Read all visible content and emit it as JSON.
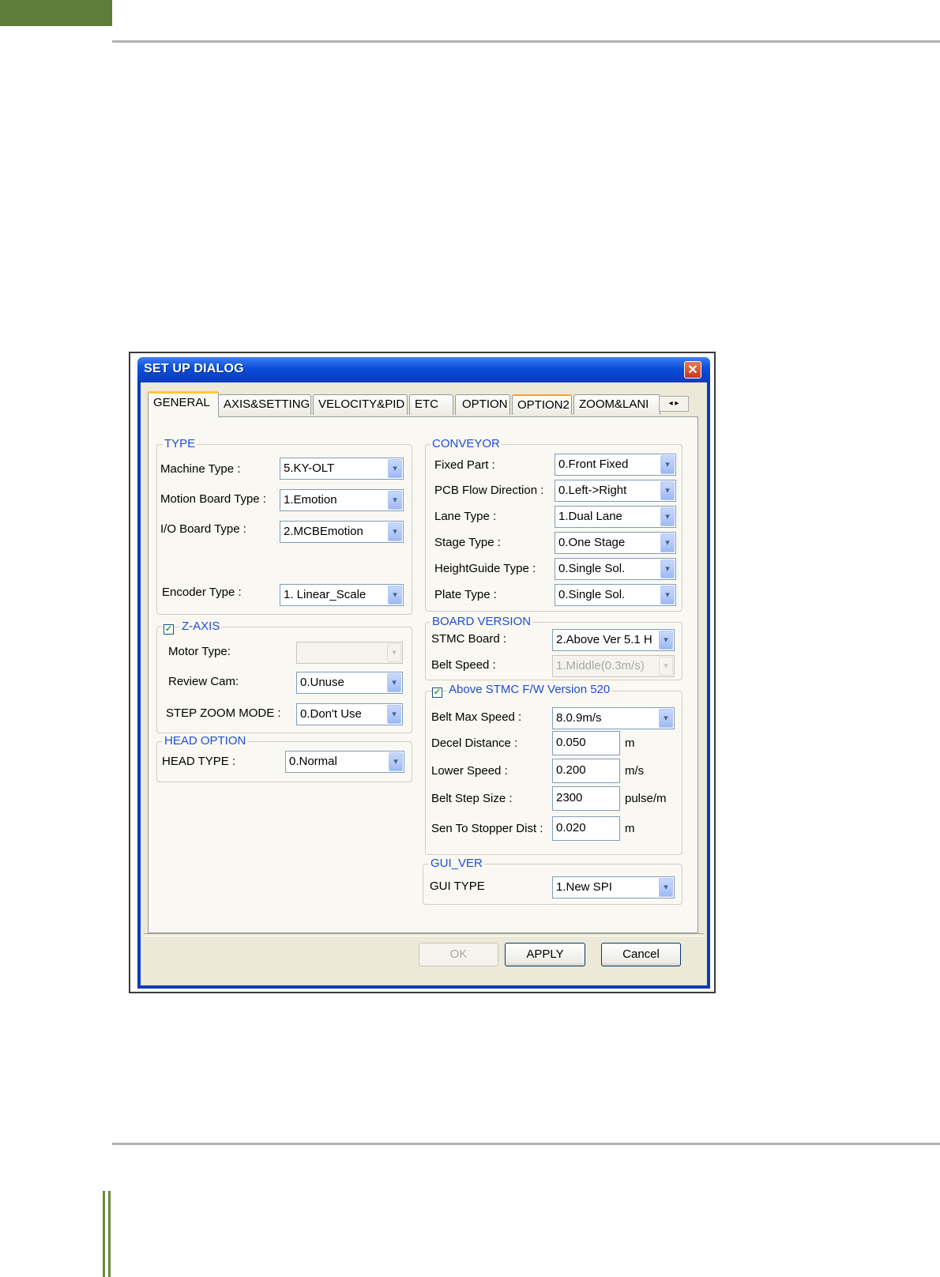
{
  "dialog": {
    "title": "SET UP DIALOG",
    "close_glyph": "✕",
    "tabs": [
      "GENERAL",
      "AXIS&SETTING",
      "VELOCITY&PID",
      "ETC",
      "OPTION",
      "OPTION2",
      "ZOOM&LANI"
    ],
    "tab_scroll": "◂ ▸",
    "type_group": {
      "legend": "TYPE",
      "machine_type": {
        "label": "Machine Type :",
        "value": "5.KY-OLT"
      },
      "motion_board_type": {
        "label": "Motion Board Type :",
        "value": "1.Emotion"
      },
      "io_board_type": {
        "label": "I/O Board Type :",
        "value": "2.MCBEmotion"
      },
      "encoder_type": {
        "label": "Encoder  Type :",
        "value": "1. Linear_Scale"
      }
    },
    "zaxis_group": {
      "legend": "Z-AXIS",
      "checked": true,
      "motor_type": {
        "label": "Motor Type:",
        "value": ""
      },
      "review_cam": {
        "label": "Review Cam:",
        "value": "0.Unuse"
      },
      "step_zoom_mode": {
        "label": "STEP ZOOM MODE :",
        "value": "0.Don't Use"
      }
    },
    "head_group": {
      "legend": "HEAD OPTION",
      "head_type": {
        "label": "HEAD TYPE :",
        "value": "0.Normal"
      }
    },
    "conveyor_group": {
      "legend": "CONVEYOR",
      "fixed_part": {
        "label": "Fixed Part :",
        "value": "0.Front Fixed"
      },
      "pcb_flow_direction": {
        "label": "PCB Flow Direction :",
        "value": "0.Left->Right"
      },
      "lane_type": {
        "label": "Lane Type :",
        "value": "1.Dual Lane"
      },
      "stage_type": {
        "label": "Stage Type :",
        "value": "0.One Stage"
      },
      "heightguide_type": {
        "label": "HeightGuide Type :",
        "value": "0.Single Sol."
      },
      "plate_type": {
        "label": "Plate Type :",
        "value": "0.Single Sol."
      }
    },
    "board_version_group": {
      "legend": "BOARD VERSION",
      "stmc_board": {
        "label": "STMC Board :",
        "value": "2.Above Ver 5.1 H"
      },
      "belt_speed": {
        "label": "Belt Speed :",
        "value": "1.Middle(0.3m/s)"
      }
    },
    "stmc_fw_group": {
      "legend": "Above STMC F/W Version 520",
      "checked": true,
      "belt_max_speed": {
        "label": "Belt Max Speed :",
        "value": "8.0.9m/s"
      },
      "decel_distance": {
        "label": "Decel Distance :",
        "value": "0.050",
        "unit": "m"
      },
      "lower_speed": {
        "label": "Lower Speed :",
        "value": "0.200",
        "unit": "m/s"
      },
      "belt_step_size": {
        "label": "Belt Step Size :",
        "value": "2300",
        "unit": "pulse/m"
      },
      "sen_to_stopper_dist": {
        "label": "Sen To Stopper Dist :",
        "value": "0.020",
        "unit": "m"
      }
    },
    "gui_ver_group": {
      "legend": "GUI_VER",
      "gui_type": {
        "label": "GUI TYPE",
        "value": "1.New SPI"
      }
    },
    "buttons": {
      "ok": "OK",
      "apply": "APPLY",
      "cancel": "Cancel"
    },
    "combo_arrow": "▾",
    "check_glyph": "✓"
  },
  "colors": {
    "title_bar": "#0a4ed8",
    "group_legend": "#1e4fd0",
    "dialog_face": "#ece9d8",
    "page_accent_green": "#5f7d3a"
  }
}
